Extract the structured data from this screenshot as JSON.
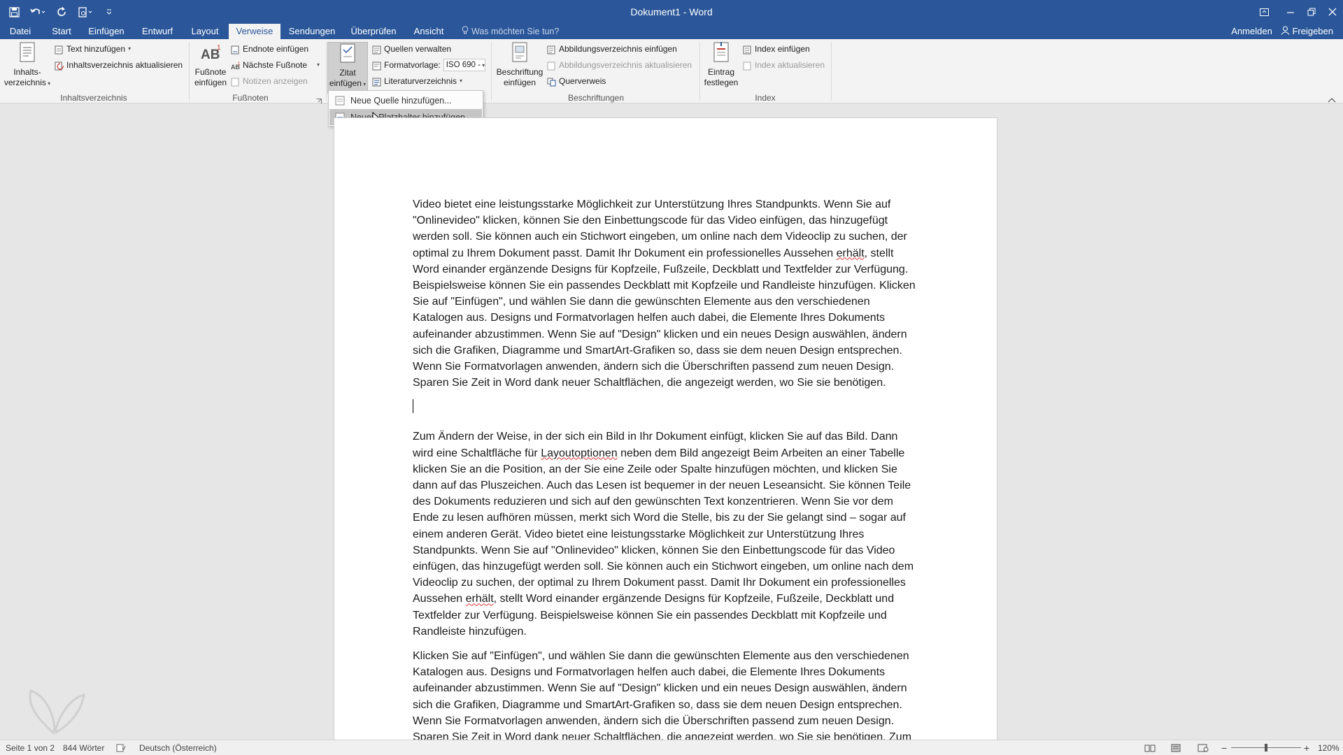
{
  "window": {
    "title": "Dokument1 - Word"
  },
  "tabs": [
    {
      "label": "Datei"
    },
    {
      "label": "Start"
    },
    {
      "label": "Einfügen"
    },
    {
      "label": "Entwurf"
    },
    {
      "label": "Layout"
    },
    {
      "label": "Verweise",
      "active": true
    },
    {
      "label": "Sendungen"
    },
    {
      "label": "Überprüfen"
    },
    {
      "label": "Ansicht"
    }
  ],
  "tell_me": "Was möchten Sie tun?",
  "account": {
    "signin": "Anmelden",
    "share": "Freigeben"
  },
  "ribbon": {
    "toc": {
      "big_label_1": "Inhalts-",
      "big_label_2": "verzeichnis",
      "add_text": "Text hinzufügen",
      "update": "Inhaltsverzeichnis aktualisieren",
      "group": "Inhaltsverzeichnis"
    },
    "footnotes": {
      "insert_1": "Fußnote",
      "insert_2": "einfügen",
      "endnote": "Endnote einfügen",
      "next": "Nächste Fußnote",
      "show": "Notizen anzeigen",
      "group": "Fußnoten"
    },
    "citations": {
      "insert_1": "Zitat",
      "insert_2": "einfügen",
      "manage": "Quellen verwalten",
      "style_label": "Formatvorlage:",
      "style_value": "ISO 690 -",
      "bibliography": "Literaturverzeichnis"
    },
    "captions": {
      "insert_1": "Beschriftung",
      "insert_2": "einfügen",
      "table_of_figures": "Abbildungsverzeichnis einfügen",
      "update_table": "Abbildungsverzeichnis aktualisieren",
      "cross_ref": "Querverweis",
      "group": "Beschriftungen"
    },
    "index": {
      "mark_1": "Eintrag",
      "mark_2": "festlegen",
      "insert": "Index einfügen",
      "update": "Index aktualisieren",
      "group": "Index"
    }
  },
  "citation_menu": {
    "items": [
      {
        "label": "Neue Quelle hinzufügen..."
      },
      {
        "label": "Neuen Platzhalter hinzufügen..."
      }
    ]
  },
  "document": {
    "p1_a": "Video bietet eine leistungsstarke Möglichkeit zur Unterstützung Ihres Standpunkts. Wenn Sie auf \"Onlinevideo\" klicken, können Sie den Einbettungscode für das Video einfügen, das hinzugefügt werden soll. Sie können auch ein Stichwort eingeben, um online nach dem Videoclip zu suchen, der optimal zu Ihrem Dokument passt. Damit Ihr Dokument ein professionelles Aussehen ",
    "p1_sq": "erhält",
    "p1_b": ", stellt Word einander ergänzende Designs für Kopfzeile, Fußzeile, Deckblatt und Textfelder zur Verfügung. Beispielsweise können Sie ein passendes Deckblatt mit Kopfzeile und Randleiste hinzufügen. Klicken Sie auf \"Einfügen\", und wählen Sie dann die gewünschten Elemente aus den verschiedenen Katalogen aus. Designs und Formatvorlagen helfen auch dabei, die Elemente Ihres Dokuments aufeinander abzustimmen. Wenn Sie auf \"Design\" klicken und ein neues Design auswählen, ändern sich die Grafiken, Diagramme und SmartArt-Grafiken so, dass sie dem neuen Design entsprechen. Wenn Sie Formatvorlagen anwenden, ändern sich die Überschriften passend zum neuen Design. Sparen Sie Zeit in Word dank neuer Schaltflächen, die angezeigt werden, wo Sie sie benötigen.",
    "p2_a": "Zum Ändern der Weise, in der sich ein Bild in Ihr Dokument einfügt, klicken Sie auf das Bild. Dann wird eine Schaltfläche für ",
    "p2_sq1": "Layoutoptionen",
    "p2_b": " neben dem Bild angezeigt Beim Arbeiten an einer Tabelle klicken Sie an die Position, an der Sie eine Zeile oder Spalte hinzufügen möchten, und klicken Sie dann auf das Pluszeichen. Auch das Lesen ist bequemer in der neuen Leseansicht. Sie können Teile des Dokuments reduzieren und sich auf den gewünschten Text konzentrieren. Wenn Sie vor dem Ende zu lesen aufhören müssen, merkt sich Word die Stelle, bis zu der Sie gelangt sind – sogar auf einem anderen Gerät. Video bietet eine leistungsstarke Möglichkeit zur Unterstützung Ihres Standpunkts. Wenn Sie auf \"Onlinevideo\" klicken, können Sie den Einbettungscode für das Video einfügen, das hinzugefügt werden soll. Sie können auch ein Stichwort eingeben, um online nach dem Videoclip zu suchen, der optimal zu Ihrem Dokument passt. Damit Ihr Dokument ein professionelles Aussehen ",
    "p2_sq2": "erhält",
    "p2_c": ", stellt Word einander ergänzende Designs für Kopfzeile, Fußzeile, Deckblatt und Textfelder zur Verfügung. Beispielsweise können Sie ein passendes Deckblatt mit Kopfzeile und Randleiste hinzufügen.",
    "p3": "Klicken Sie auf \"Einfügen\", und wählen Sie dann die gewünschten Elemente aus den verschiedenen Katalogen aus. Designs und Formatvorlagen helfen auch dabei, die Elemente Ihres Dokuments aufeinander abzustimmen. Wenn Sie auf \"Design\" klicken und ein neues Design auswählen, ändern sich die Grafiken, Diagramme und SmartArt-Grafiken so, dass sie dem neuen Design entsprechen. Wenn Sie Formatvorlagen anwenden, ändern sich die Überschriften passend zum neuen Design. Sparen Sie Zeit in Word dank neuer Schaltflächen, die angezeigt werden, wo Sie sie benötigen. Zum"
  },
  "status": {
    "page": "Seite 1 von 2",
    "words": "844 Wörter",
    "language": "Deutsch (Österreich)",
    "zoom": "120%"
  },
  "colors": {
    "brand": "#2b579a",
    "ribbon": "#f3f3f3",
    "canvas": "#e6e6e6"
  }
}
